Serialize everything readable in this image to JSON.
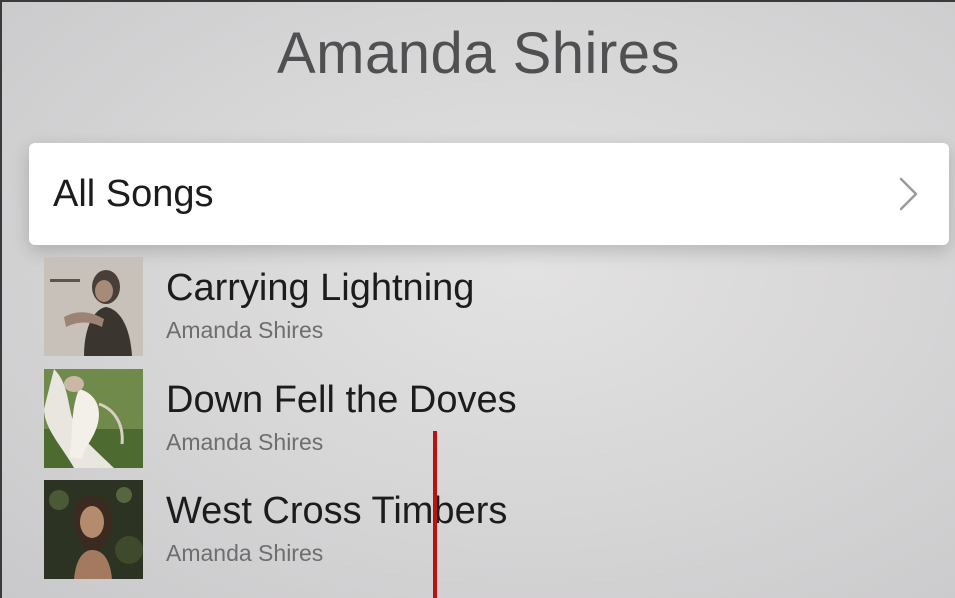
{
  "header": {
    "title": "Amanda Shires"
  },
  "all_songs": {
    "label": "All Songs",
    "icon": "chevron-right-icon"
  },
  "songs": [
    {
      "title": "Carrying Lightning",
      "artist": "Amanda Shires",
      "artwork_icon": "album-art-carrying-lightning"
    },
    {
      "title": "Down Fell the Doves",
      "artist": "Amanda Shires",
      "artwork_icon": "album-art-down-fell-the-doves"
    },
    {
      "title": "West Cross Timbers",
      "artist": "Amanda Shires",
      "artwork_icon": "album-art-west-cross-timbers"
    }
  ],
  "colors": {
    "background": "#d8d7d8",
    "card": "#ffffff",
    "title_text": "#505052",
    "primary_text": "#1c1c1c",
    "secondary_text": "#6e6e70",
    "indicator_line": "#b81212"
  }
}
